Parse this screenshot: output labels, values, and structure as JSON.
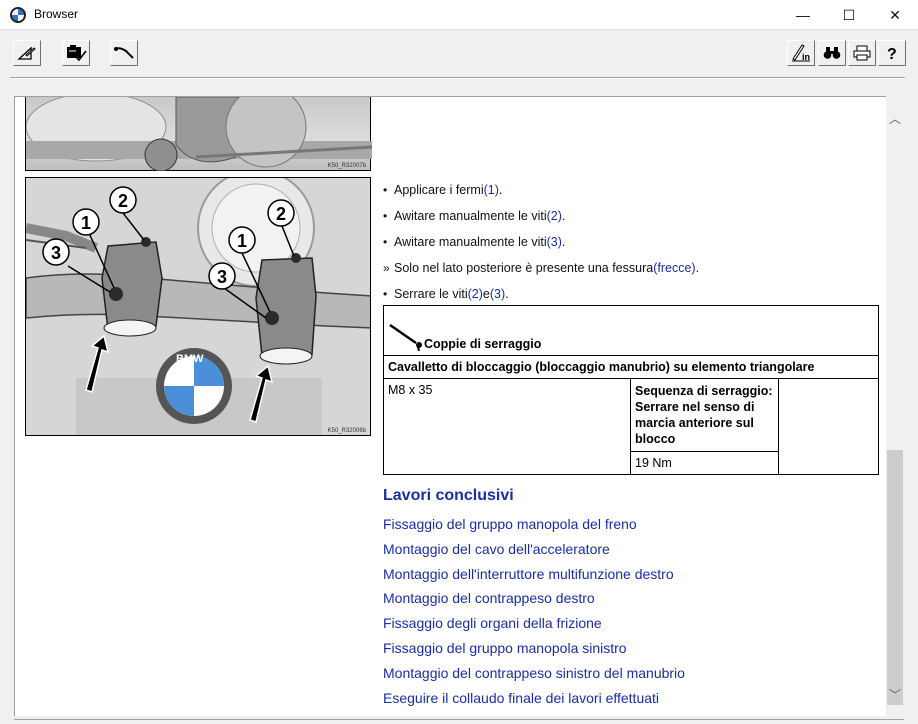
{
  "window": {
    "title": "Browser",
    "controls": {
      "minimize": "—",
      "maximize": "☐",
      "close": "✕"
    }
  },
  "toolbar": {
    "left_buttons": [
      "edit-triangle-icon",
      "document-check-icon",
      "wrench-icon"
    ],
    "right_buttons": [
      "info-pen-icon",
      "binoculars-icon",
      "printer-icon",
      "help-icon"
    ]
  },
  "figures": {
    "top_code": "K50_R32007b",
    "main_code": "K50_R32006b",
    "callouts": [
      "1",
      "2",
      "3",
      "1",
      "2",
      "3"
    ],
    "logo_text": "BMW"
  },
  "steps": [
    {
      "bullet": "•",
      "text": "Applicare i fermi ",
      "ref": "(1)",
      "tail": "."
    },
    {
      "bullet": "•",
      "text": "Awitare manualmente le viti ",
      "ref": "(2)",
      "tail": "."
    },
    {
      "bullet": "•",
      "text": "Awitare manualmente le viti ",
      "ref": "(3)",
      "tail": "."
    },
    {
      "bullet": "»",
      "text": "Solo nel lato posteriore è presente una fessura ",
      "ref": "(frecce)",
      "tail": "."
    },
    {
      "bullet": "•",
      "text": "Serrare le viti ",
      "ref": "(2)",
      "mid": " e ",
      "ref2": "(3)",
      "tail": "."
    }
  ],
  "torque_table": {
    "heading": "Coppie di serraggio",
    "subheading": "Cavalletto di bloccaggio (bloccaggio manubrio) su elemento triangolare",
    "spec": "M8 x 35",
    "sequence": "Sequenza di serraggio: Serrare nel senso di marcia anteriore sul blocco",
    "value": "19 Nm"
  },
  "closing": {
    "title": "Lavori conclusivi",
    "links": [
      "Fissaggio del gruppo manopola del freno",
      "Montaggio del cavo dell'acceleratore",
      "Montaggio dell'interruttore multifunzione destro",
      "Montaggio del contrappeso destro",
      "Fissaggio degli organi della frizione",
      "Fissaggio del gruppo manopola sinistro",
      "Montaggio del contrappeso sinistro del manubrio",
      "Eseguire il collaudo finale dei lavori effettuati"
    ]
  },
  "scrollbar": {
    "up": "︿",
    "down": "﹀"
  }
}
